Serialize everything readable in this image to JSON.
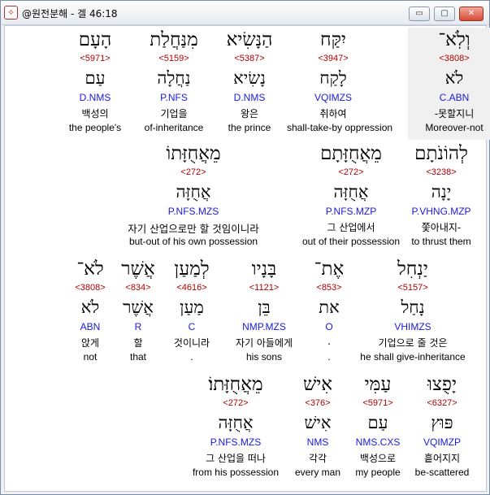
{
  "window": {
    "title": "@원전분해 - 겔 46:18",
    "controls": {
      "minimize": "▭",
      "maximize": "▢",
      "close": "✕"
    }
  },
  "rows": [
    {
      "words": [
        {
          "hebrew": "וְלֹֽא־",
          "strong": "<3808>",
          "lemma": "לֹא",
          "morph": "C.ABN",
          "korean": "-못할지니",
          "english": "Moreover-not",
          "highlight": true
        },
        {
          "hebrew": "יִקַּח",
          "strong": "<3947>",
          "lemma": "לָקַח",
          "morph": "VQIMZS",
          "korean": "취하여",
          "english": "shall-take-by oppression"
        },
        {
          "hebrew": "הַנָּשִׂיא",
          "strong": "<5387>",
          "lemma": "נָשִׂיא",
          "morph": "D.NMS",
          "korean": "왕은",
          "english": "the prince"
        },
        {
          "hebrew": "מִנַּחֲלַת",
          "strong": "<5159>",
          "lemma": "נַחֲלָה",
          "morph": "P.NFS",
          "korean": "기업을",
          "english": "of-inheritance"
        },
        {
          "hebrew": "הָעָם",
          "strong": "<5971>",
          "lemma": "עַם",
          "morph": "D.NMS",
          "korean": "백성의",
          "english": "the people's"
        }
      ]
    },
    {
      "words": [
        {
          "hebrew": "לְהוֹנֹתָם",
          "strong": "<3238>",
          "lemma": "יָנָה",
          "morph": "P.VHNG.MZP",
          "korean": "쫓아내지-",
          "english": "to thrust them"
        },
        {
          "hebrew": "מֵאֲחֻזָּתָם",
          "strong": "<272>",
          "lemma": "אֲחֻזָּה",
          "morph": "P.NFS.MZP",
          "korean": "그 산업에서",
          "english": "out of their possession"
        },
        {
          "hebrew": "מֵאֲחֻזָּתוֹ",
          "strong": "<272>",
          "lemma": "אֲחֻזָּה",
          "morph": "P.NFS.MZS",
          "korean": "자기 산업으로만 할 것임이니라",
          "english": "but-out of his own possession"
        }
      ]
    },
    {
      "words": [
        {
          "hebrew": "יַנְחִל",
          "strong": "<5157>",
          "lemma": "נָחַל",
          "morph": "VHIMZS",
          "korean": "기업으로 줄 것은",
          "english": "he shall give-inheritance"
        },
        {
          "hebrew": "אֶת־",
          "strong": "<853>",
          "lemma": "את",
          "morph": "O",
          "korean": ".",
          "english": "."
        },
        {
          "hebrew": "בָּנָיו",
          "strong": "<1121>",
          "lemma": "בֵּן",
          "morph": "NMP.MZS",
          "korean": "자기 아들에게",
          "english": "his sons"
        },
        {
          "hebrew": "לְמַעַן",
          "strong": "<4616>",
          "lemma": "מַעַן",
          "morph": "C",
          "korean": "것이니라",
          "english": "."
        },
        {
          "hebrew": "אֲשֶׁר",
          "strong": "<834>",
          "lemma": "אֲשֶׁר",
          "morph": "R",
          "korean": "할",
          "english": "that"
        },
        {
          "hebrew": "לֹא־",
          "strong": "<3808>",
          "lemma": "לֹא",
          "morph": "ABN",
          "korean": "앉게",
          "english": "not"
        }
      ]
    },
    {
      "words": [
        {
          "hebrew": "יָפֻצוּ",
          "strong": "<6327>",
          "lemma": "פּוּץ",
          "morph": "VQIMZP",
          "korean": "흩어지지",
          "english": "be-scattered"
        },
        {
          "hebrew": "עַמִּי",
          "strong": "<5971>",
          "lemma": "עַם",
          "morph": "NMS.CXS",
          "korean": "백성으로",
          "english": "my people"
        },
        {
          "hebrew": "אִישׁ",
          "strong": "<376>",
          "lemma": "אִישׁ",
          "morph": "NMS",
          "korean": "각각",
          "english": "every man"
        },
        {
          "hebrew": "מֵאֲחֻזָּתוֹ׃",
          "strong": "<272>",
          "lemma": "אֲחֻזָּה",
          "morph": "P.NFS.MZS",
          "korean": "그 산업을 떠나",
          "english": "from his possession"
        }
      ]
    }
  ],
  "colors": {
    "strong": "#b00000",
    "morph": "#1a1adb",
    "highlight_bg": "#f0f0f0"
  }
}
